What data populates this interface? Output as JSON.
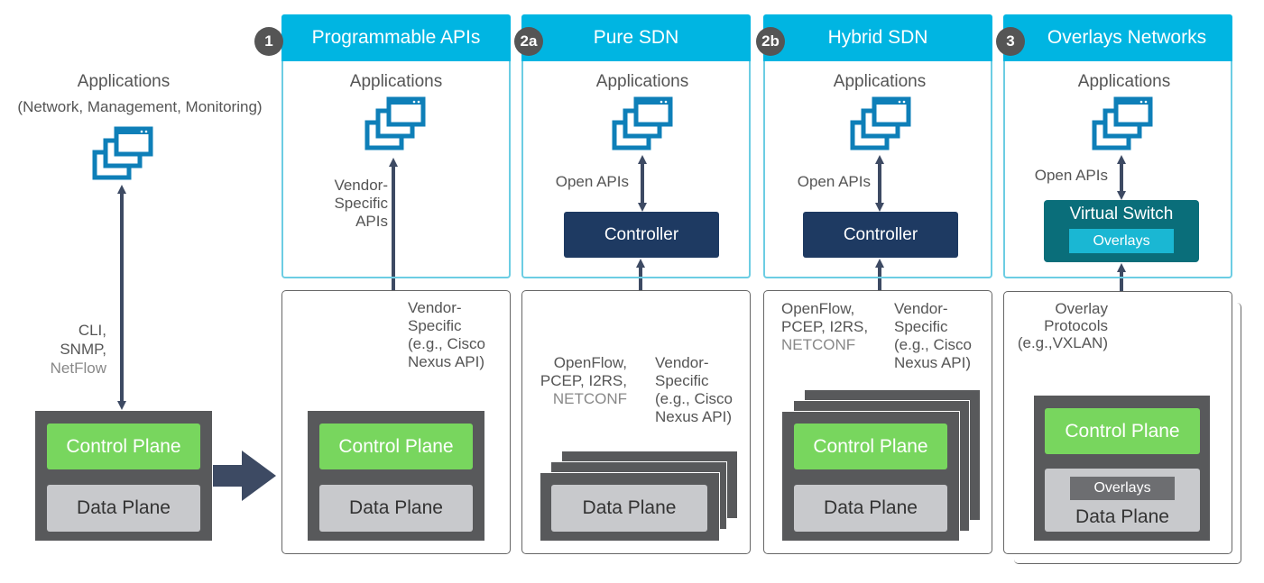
{
  "colors": {
    "header": "#00b5e2",
    "control_plane": "#78d65e",
    "data_plane": "#c8c9cc",
    "device": "#58595b",
    "controller": "#1e3a62",
    "virtual_switch": "#0a6e7a",
    "arrow": "#3d4a63",
    "app_icon": "#0e7fb8"
  },
  "legacy": {
    "apps_title": "Applications",
    "apps_subtitle": "(Network, Management, Monitoring)",
    "protocols": [
      "CLI,",
      "SNMP,",
      "NetFlow"
    ],
    "control_plane": "Control Plane",
    "data_plane": "Data Plane"
  },
  "panels": [
    {
      "badge": "1",
      "title": "Programmable APIs",
      "apps": "Applications",
      "upper_label": [
        "Vendor-",
        "Specific",
        "APIs"
      ],
      "lower_label": [
        "Vendor-",
        "Specific",
        "(e.g., Cisco",
        "Nexus API)"
      ],
      "control_plane": "Control Plane",
      "data_plane": "Data Plane"
    },
    {
      "badge": "2a",
      "title": "Pure SDN",
      "apps": "Applications",
      "upper_label": "Open APIs",
      "controller": "Controller",
      "left_label": [
        "OpenFlow,",
        "PCEP, I2RS,",
        "NETCONF"
      ],
      "right_label": [
        "Vendor-",
        "Specific",
        "(e.g., Cisco",
        "Nexus API)"
      ],
      "data_plane": "Data Plane"
    },
    {
      "badge": "2b",
      "title": "Hybrid SDN",
      "apps": "Applications",
      "upper_label": "Open APIs",
      "controller": "Controller",
      "left_label": [
        "OpenFlow,",
        "PCEP, I2RS,",
        "NETCONF"
      ],
      "right_label": [
        "Vendor-",
        "Specific",
        "(e.g., Cisco",
        "Nexus API)"
      ],
      "control_plane": "Control Plane",
      "data_plane": "Data Plane"
    },
    {
      "badge": "3",
      "title": "Overlays Networks",
      "apps": "Applications",
      "upper_label": "Open APIs",
      "virtual_switch": "Virtual Switch",
      "vs_overlays": "Overlays",
      "lower_label": [
        "Overlay",
        "Protocols",
        "(e.g.,VXLAN)"
      ],
      "control_plane": "Control Plane",
      "dp_overlays": "Overlays",
      "data_plane": "Data Plane"
    }
  ]
}
